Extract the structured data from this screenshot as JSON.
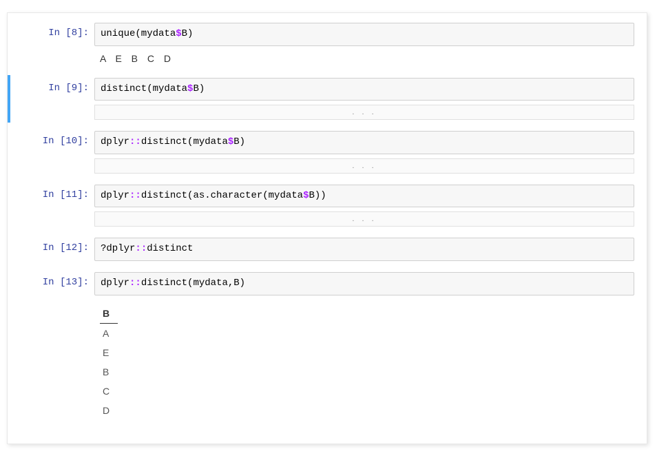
{
  "cells": [
    {
      "prompt": "In [8]:",
      "code_tokens": [
        "unique(mydata",
        {
          "t": "$",
          "c": "tok-dollar"
        },
        "B)"
      ],
      "output_text": "A  E  B  C  D",
      "selected": false
    },
    {
      "prompt": "In [9]:",
      "code_tokens": [
        "distinct(mydata",
        {
          "t": "$",
          "c": "tok-dollar"
        },
        "B)"
      ],
      "collapsed_output": true,
      "selected": true
    },
    {
      "prompt": "In [10]:",
      "code_tokens": [
        "dplyr",
        {
          "t": "::",
          "c": "tok-dcolon"
        },
        "distinct(mydata",
        {
          "t": "$",
          "c": "tok-dollar"
        },
        "B)"
      ],
      "collapsed_output": true,
      "selected": false
    },
    {
      "prompt": "In [11]:",
      "code_tokens": [
        "dplyr",
        {
          "t": "::",
          "c": "tok-dcolon"
        },
        "distinct(as.character(mydata",
        {
          "t": "$",
          "c": "tok-dollar"
        },
        "B))"
      ],
      "collapsed_output": true,
      "selected": false
    },
    {
      "prompt": "In [12]:",
      "code_tokens": [
        "?dplyr",
        {
          "t": "::",
          "c": "tok-dcolon"
        },
        "distinct"
      ],
      "selected": false
    },
    {
      "prompt": "In [13]:",
      "code_tokens": [
        "dplyr",
        {
          "t": "::",
          "c": "tok-dcolon"
        },
        "distinct(mydata,B)"
      ],
      "output_table": {
        "header": "B",
        "rows": [
          "A",
          "E",
          "B",
          "C",
          "D"
        ]
      },
      "selected": false
    }
  ],
  "collapse_dots": ". . ."
}
